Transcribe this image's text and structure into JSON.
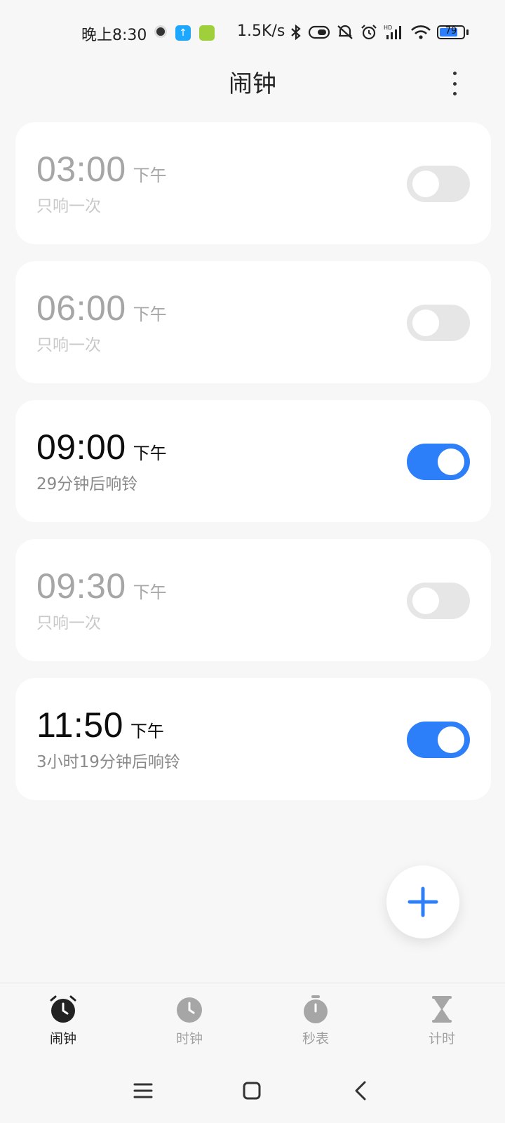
{
  "status_bar": {
    "time": "晚上8:30",
    "network_speed": "1.5K/s",
    "battery_level": "79",
    "battery_fraction": 0.79,
    "icons": [
      "clock-app-icon",
      "upload-icon",
      "game-icon",
      "bluetooth-icon",
      "toggle-icon",
      "mute-icon",
      "alarm-icon",
      "signal-icon",
      "wifi-icon",
      "battery-icon"
    ]
  },
  "header": {
    "title": "闹钟"
  },
  "alarms": [
    {
      "time": "03:00",
      "period": "下午",
      "subtitle": "只响一次",
      "enabled": false
    },
    {
      "time": "06:00",
      "period": "下午",
      "subtitle": "只响一次",
      "enabled": false
    },
    {
      "time": "09:00",
      "period": "下午",
      "subtitle": "29分钟后响铃",
      "enabled": true
    },
    {
      "time": "09:30",
      "period": "下午",
      "subtitle": "只响一次",
      "enabled": false
    },
    {
      "time": "11:50",
      "period": "下午",
      "subtitle": "3小时19分钟后响铃",
      "enabled": true
    }
  ],
  "bottom_nav": {
    "items": [
      {
        "label": "闹钟",
        "icon": "alarm-clock-icon",
        "active": true
      },
      {
        "label": "时钟",
        "icon": "clock-icon",
        "active": false
      },
      {
        "label": "秒表",
        "icon": "stopwatch-icon",
        "active": false
      },
      {
        "label": "计时",
        "icon": "hourglass-icon",
        "active": false
      }
    ]
  },
  "colors": {
    "accent": "#2d7ff9",
    "background": "#f7f7f7",
    "card": "#ffffff",
    "toggle_off": "#e6e6e6"
  }
}
